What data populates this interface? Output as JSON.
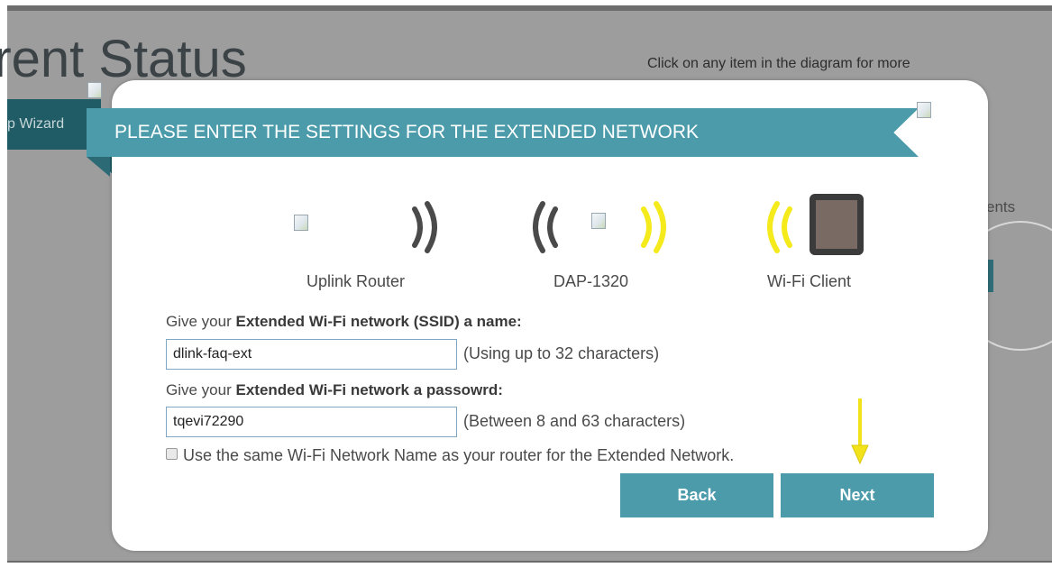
{
  "background": {
    "page_title": "rrent Status",
    "hint_text": "Click on any item in the diagram for more",
    "wizard_tab": "p Wizard",
    "side_text": "ents"
  },
  "modal": {
    "heading": "PLEASE ENTER THE SETTINGS FOR THE EXTENDED NETWORK",
    "diagram": {
      "uplink_label": "Uplink Router",
      "extender_label": "DAP-1320",
      "client_label": "Wi-Fi Client"
    },
    "ssid": {
      "label_prefix": "Give your ",
      "label_bold": "Extended Wi-Fi network (SSID) a name:",
      "value": "dlink-faq-ext",
      "hint": "(Using up to 32 characters)"
    },
    "password": {
      "label_prefix": "Give your ",
      "label_bold": "Extended Wi-Fi network a passowrd:",
      "value": "tqevi72290",
      "hint": "(Between 8 and 63 characters)"
    },
    "same_name_checkbox": {
      "checked": false,
      "label": "Use the same Wi-Fi Network Name as your router for the Extended Network."
    },
    "buttons": {
      "back": "Back",
      "next": "Next"
    }
  },
  "colors": {
    "banner": "#4b9bab",
    "button": "#4b9bab",
    "wifi_yellow": "#f4ea1c",
    "wifi_gray": "#4a4a4a",
    "arrow": "#f2e21a"
  },
  "icons": {
    "broken_image": "broken-image-icon",
    "wifi_waves": "wifi-signal-icon",
    "tablet": "tablet-icon",
    "annotation_arrow": "down-arrow-icon"
  }
}
